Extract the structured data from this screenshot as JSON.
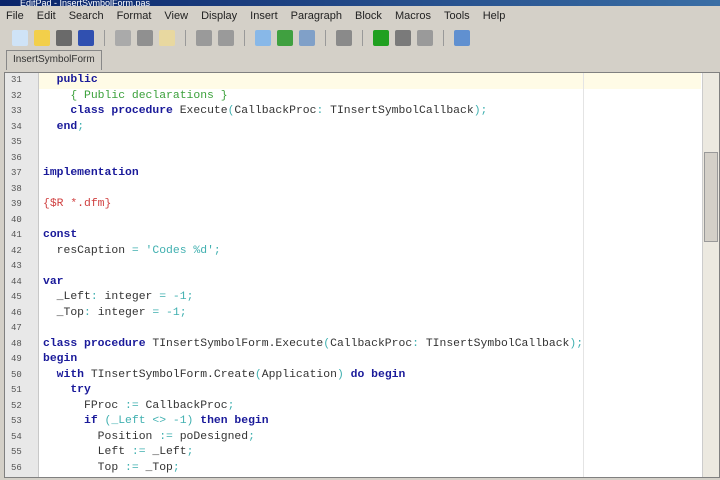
{
  "window": {
    "title": "EditPad - InsertSymbolForm.pas"
  },
  "menu": [
    "File",
    "Edit",
    "Search",
    "Format",
    "View",
    "Display",
    "Insert",
    "Paragraph",
    "Block",
    "Macros",
    "Tools",
    "Help"
  ],
  "toolbar": [
    {
      "icon": "new-file-icon",
      "color": "#cfe3f7"
    },
    {
      "icon": "open-folder-icon",
      "color": "#f2cf4a"
    },
    {
      "icon": "save-icon",
      "color": "#6a6a6a"
    },
    {
      "icon": "save-all-icon",
      "color": "#3050b0"
    },
    {
      "sep": true
    },
    {
      "icon": "cut-icon",
      "color": "#aaaaaa"
    },
    {
      "icon": "copy-icon",
      "color": "#909090"
    },
    {
      "icon": "paste-icon",
      "color": "#e8d8a0"
    },
    {
      "sep": true
    },
    {
      "icon": "undo-icon",
      "color": "#9a9a9a"
    },
    {
      "icon": "redo-icon",
      "color": "#9a9a9a"
    },
    {
      "sep": true
    },
    {
      "icon": "search-icon",
      "color": "#88b8e8"
    },
    {
      "icon": "replace-icon",
      "color": "#40a040"
    },
    {
      "icon": "find-in-files-icon",
      "color": "#80a0c8"
    },
    {
      "sep": true
    },
    {
      "icon": "pilcrow-icon",
      "color": "#8a8a8a"
    },
    {
      "sep": true
    },
    {
      "icon": "record-macro-icon",
      "color": "#20a020"
    },
    {
      "icon": "stop-macro-icon",
      "color": "#7a7a7a"
    },
    {
      "icon": "play-macro-icon",
      "color": "#9a9a9a"
    },
    {
      "sep": true
    },
    {
      "icon": "options-icon",
      "color": "#6090d0"
    }
  ],
  "tabs": [
    {
      "label": "InsertSymbolForm",
      "active": true
    }
  ],
  "editor": {
    "current_line": 31,
    "lines": [
      {
        "n": "31",
        "seg": [
          [
            "",
            "  "
          ],
          [
            "kw",
            "public"
          ]
        ]
      },
      {
        "n": "32",
        "seg": [
          [
            "",
            "    "
          ],
          [
            "cm",
            "{ Public declarations }"
          ]
        ]
      },
      {
        "n": "33",
        "seg": [
          [
            "",
            "    "
          ],
          [
            "kw",
            "class procedure"
          ],
          [
            "",
            " Execute"
          ],
          [
            "sy",
            "("
          ],
          [
            "",
            "CallbackProc"
          ],
          [
            "sy",
            ":"
          ],
          [
            "",
            " TInsertSymbolCallback"
          ],
          [
            "sy",
            ");"
          ]
        ]
      },
      {
        "n": "34",
        "seg": [
          [
            "",
            "  "
          ],
          [
            "kw",
            "end"
          ],
          [
            "sy",
            ";"
          ]
        ]
      },
      {
        "n": "35",
        "seg": []
      },
      {
        "n": "36",
        "seg": []
      },
      {
        "n": "37",
        "seg": [
          [
            "kw",
            "implementation"
          ]
        ]
      },
      {
        "n": "38",
        "seg": []
      },
      {
        "n": "39",
        "seg": [
          [
            "dr",
            "{$R *.dfm}"
          ]
        ]
      },
      {
        "n": "40",
        "seg": []
      },
      {
        "n": "41",
        "seg": [
          [
            "kw",
            "const"
          ]
        ]
      },
      {
        "n": "42",
        "seg": [
          [
            "",
            "  resCaption "
          ],
          [
            "sy",
            "="
          ],
          [
            "st",
            " 'Codes %d'"
          ],
          [
            "sy",
            ";"
          ]
        ]
      },
      {
        "n": "43",
        "seg": []
      },
      {
        "n": "44",
        "seg": [
          [
            "kw",
            "var"
          ]
        ]
      },
      {
        "n": "45",
        "seg": [
          [
            "",
            "  _Left"
          ],
          [
            "sy",
            ":"
          ],
          [
            "",
            " integer "
          ],
          [
            "sy",
            "= -1;"
          ]
        ]
      },
      {
        "n": "46",
        "seg": [
          [
            "",
            "  _Top"
          ],
          [
            "sy",
            ":"
          ],
          [
            "",
            " integer "
          ],
          [
            "sy",
            "= -1;"
          ]
        ]
      },
      {
        "n": "47",
        "seg": []
      },
      {
        "n": "48",
        "seg": [
          [
            "kw",
            "class procedure"
          ],
          [
            "",
            " TInsertSymbolForm.Execute"
          ],
          [
            "sy",
            "("
          ],
          [
            "",
            "CallbackProc"
          ],
          [
            "sy",
            ":"
          ],
          [
            "",
            " TInsertSymbolCallback"
          ],
          [
            "sy",
            ");"
          ]
        ]
      },
      {
        "n": "49",
        "seg": [
          [
            "kw",
            "begin"
          ]
        ]
      },
      {
        "n": "50",
        "seg": [
          [
            "",
            "  "
          ],
          [
            "kw",
            "with"
          ],
          [
            "",
            " TInsertSymbolForm.Create"
          ],
          [
            "sy",
            "("
          ],
          [
            "",
            "Application"
          ],
          [
            "sy",
            ")"
          ],
          [
            "",
            " "
          ],
          [
            "kw",
            "do begin"
          ]
        ]
      },
      {
        "n": "51",
        "seg": [
          [
            "",
            "    "
          ],
          [
            "kw",
            "try"
          ]
        ]
      },
      {
        "n": "52",
        "seg": [
          [
            "",
            "      FProc "
          ],
          [
            "sy",
            ":="
          ],
          [
            "",
            " CallbackProc"
          ],
          [
            "sy",
            ";"
          ]
        ]
      },
      {
        "n": "53",
        "seg": [
          [
            "",
            "      "
          ],
          [
            "kw",
            "if"
          ],
          [
            "sy",
            " (_Left <> -1)"
          ],
          [
            "",
            " "
          ],
          [
            "kw",
            "then begin"
          ]
        ]
      },
      {
        "n": "54",
        "seg": [
          [
            "",
            "        Position "
          ],
          [
            "sy",
            ":="
          ],
          [
            "",
            " poDesigned"
          ],
          [
            "sy",
            ";"
          ]
        ]
      },
      {
        "n": "55",
        "seg": [
          [
            "",
            "        Left "
          ],
          [
            "sy",
            ":="
          ],
          [
            "",
            " _Left"
          ],
          [
            "sy",
            ";"
          ]
        ]
      },
      {
        "n": "56",
        "seg": [
          [
            "",
            "        Top "
          ],
          [
            "sy",
            ":="
          ],
          [
            "",
            " _Top"
          ],
          [
            "sy",
            ";"
          ]
        ]
      }
    ]
  },
  "scrollbar": {
    "position_fraction": 0.25
  }
}
